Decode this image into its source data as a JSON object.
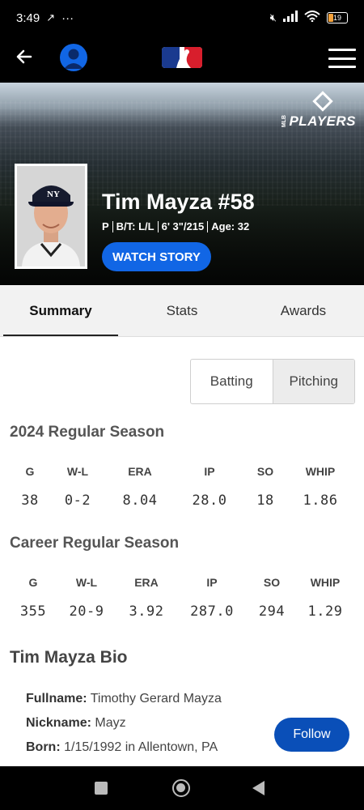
{
  "status_bar": {
    "time": "3:49",
    "battery": "19"
  },
  "header": {
    "back_icon": "arrow-left-icon",
    "avatar_icon": "user-avatar-icon",
    "logo_icon": "mlb-logo-icon",
    "menu_icon": "hamburger-menu-icon"
  },
  "hero": {
    "badge_small": "MLB",
    "badge_text": "PLAYERS",
    "player_name": "Tim Mayza #58",
    "position": "P",
    "bats_throws": "B/T: L/L",
    "height_weight": "6' 3\"/215",
    "age": "Age: 32",
    "watch_story_label": "WATCH STORY",
    "accent_color": "#1166e5"
  },
  "tabs": [
    {
      "label": "Summary",
      "active": true
    },
    {
      "label": "Stats",
      "active": false
    },
    {
      "label": "Awards",
      "active": false
    }
  ],
  "toggle": {
    "batting_label": "Batting",
    "pitching_label": "Pitching",
    "selected": "Pitching"
  },
  "season_2024": {
    "title": "2024 Regular Season",
    "headers": [
      "G",
      "W-L",
      "ERA",
      "IP",
      "SO",
      "WHIP"
    ],
    "values": [
      "38",
      "0-2",
      "8.04",
      "28.0",
      "18",
      "1.86"
    ]
  },
  "career": {
    "title": "Career Regular Season",
    "headers": [
      "G",
      "W-L",
      "ERA",
      "IP",
      "SO",
      "WHIP"
    ],
    "values": [
      "355",
      "20-9",
      "3.92",
      "287.0",
      "294",
      "1.29"
    ]
  },
  "bio": {
    "title": "Tim Mayza Bio",
    "fullname_label": "Fullname:",
    "fullname_value": "Timothy Gerard Mayza",
    "nickname_label": "Nickname:",
    "nickname_value": "Mayz",
    "born_label": "Born:",
    "born_value": "1/15/1992 in Allentown, PA",
    "follow_label": "Follow"
  }
}
